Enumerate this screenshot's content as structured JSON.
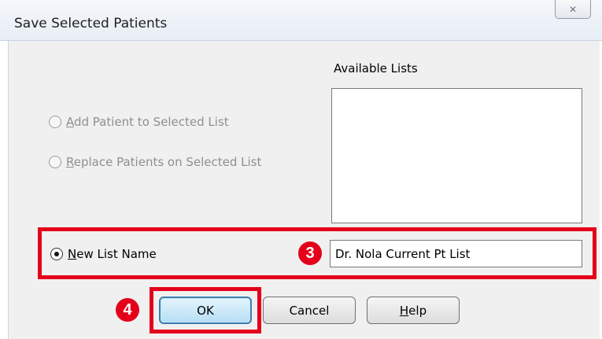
{
  "window": {
    "title": "Save Selected Patients",
    "close_glyph": "✕"
  },
  "available_lists": {
    "label": "Available Lists",
    "items": []
  },
  "options": {
    "add": {
      "mnemonic": "A",
      "rest": "dd Patient to Selected List",
      "selected": false,
      "enabled": false
    },
    "replace": {
      "mnemonic": "R",
      "rest": "eplace Patients on Selected List",
      "selected": false,
      "enabled": false
    },
    "new": {
      "mnemonic": "N",
      "rest": "ew List Name",
      "selected": true,
      "enabled": true
    }
  },
  "new_list_name": {
    "value": "Dr. Nola Current Pt List"
  },
  "buttons": {
    "ok": "OK",
    "cancel": "Cancel",
    "help_mnemonic": "H",
    "help_rest": "elp"
  },
  "callouts": {
    "step3": "3",
    "step4": "4"
  },
  "colors": {
    "callout_red": "#e4001b",
    "ok_button": "#b6def5"
  }
}
